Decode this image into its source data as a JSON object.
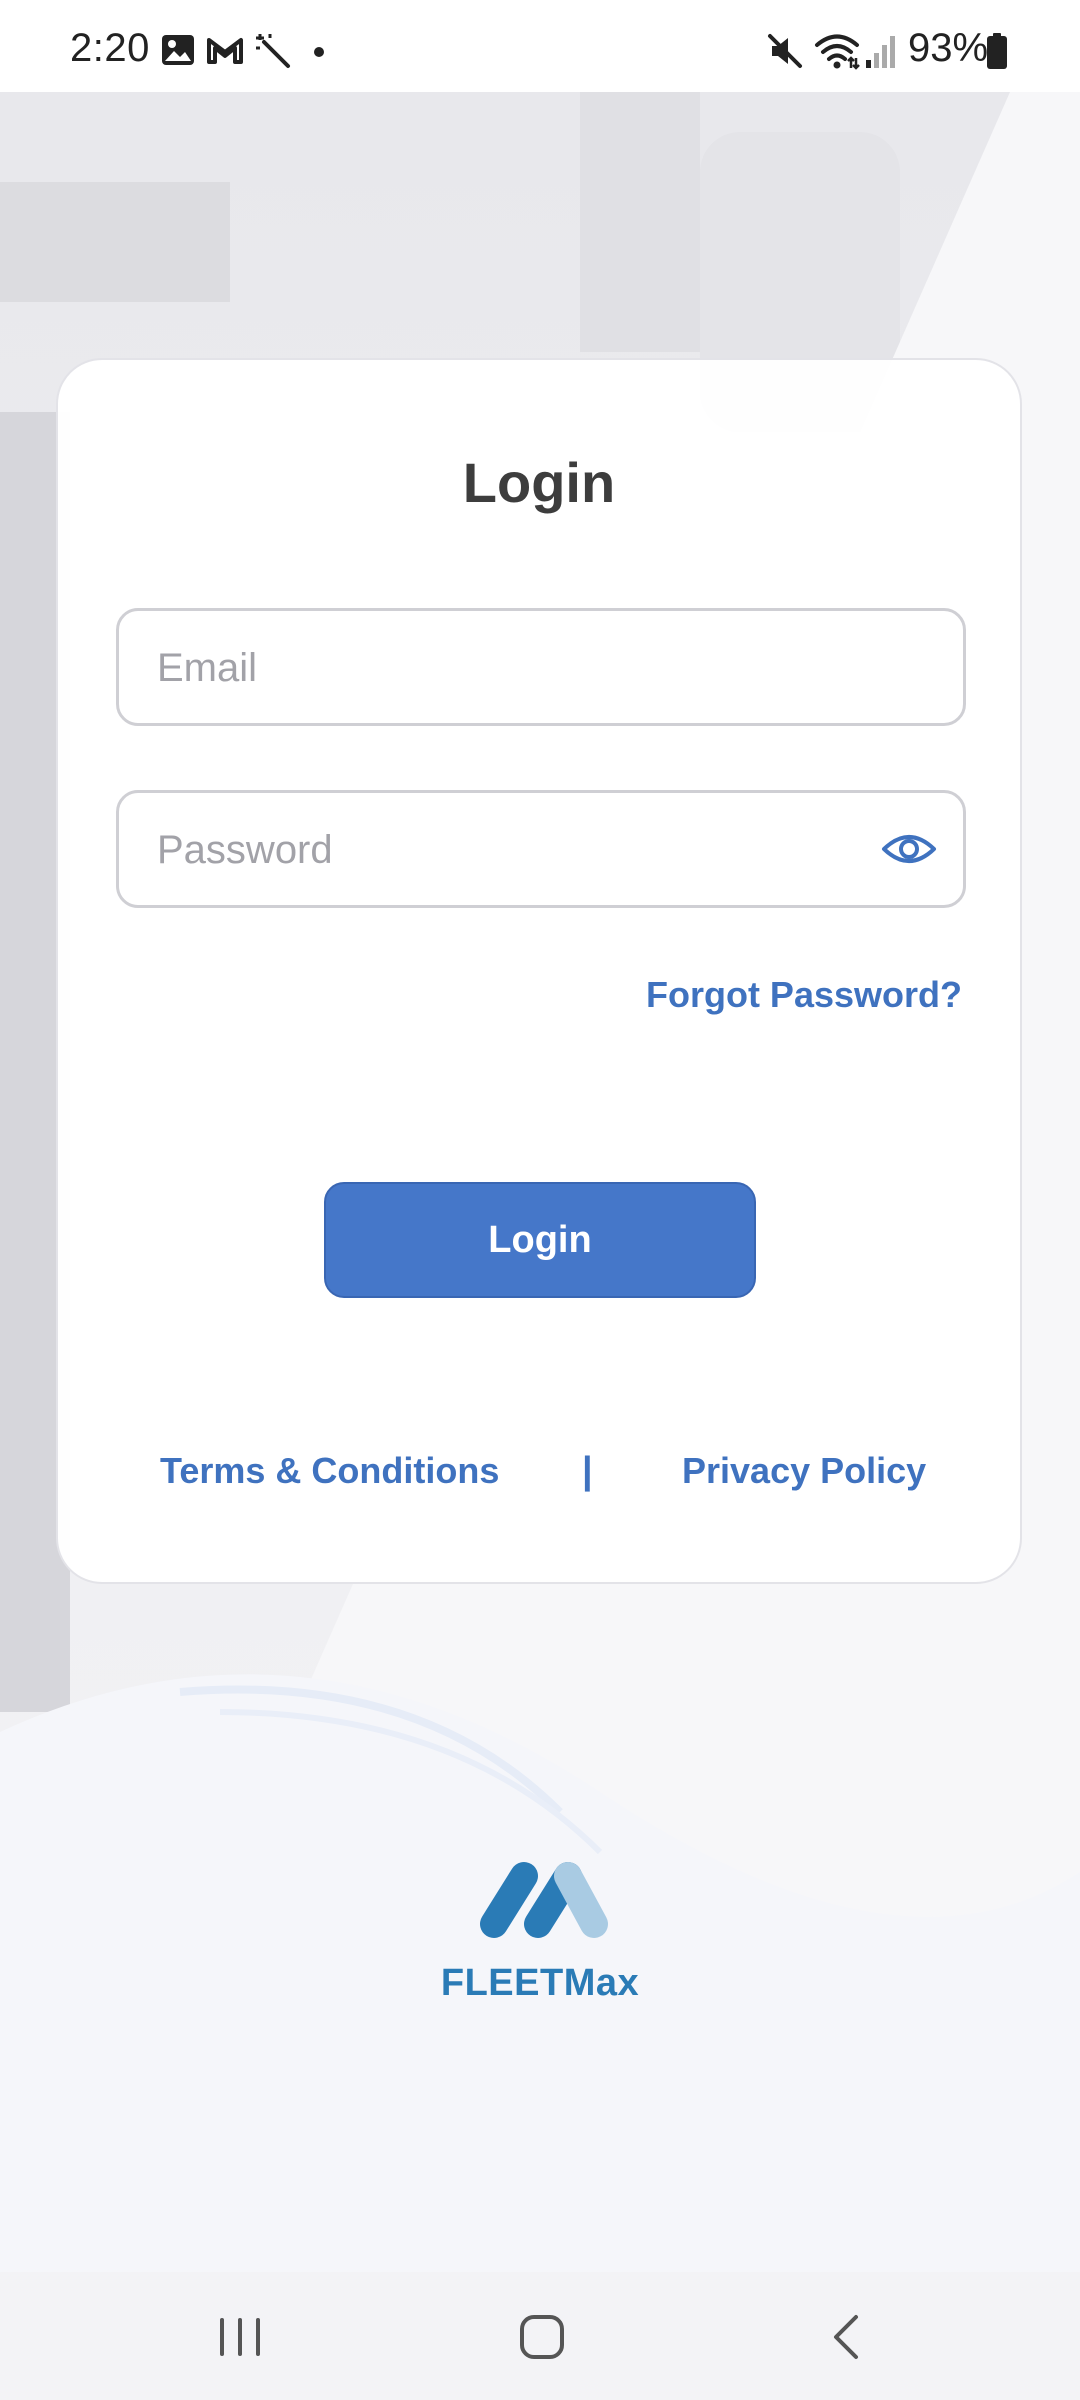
{
  "status_bar": {
    "time": "2:20",
    "battery": "93%",
    "icons": [
      "image-icon",
      "gmail-icon",
      "magic-wand-icon",
      "dot-icon",
      "mute-icon",
      "wifi-icon",
      "signal-icon",
      "battery-icon"
    ]
  },
  "login": {
    "title": "Login",
    "email_placeholder": "Email",
    "password_placeholder": "Password",
    "forgot_password": "Forgot Password?",
    "login_button": "Login",
    "terms": "Terms & Conditions",
    "divider": "|",
    "privacy": "Privacy Policy"
  },
  "brand": {
    "name": "FLEETMax"
  },
  "colors": {
    "accent": "#4577c9",
    "link": "#3f72bf",
    "brand": "#2a7bb6",
    "title": "#3d3d3d"
  },
  "navigation": {
    "buttons": [
      "recent-apps",
      "home",
      "back"
    ]
  }
}
